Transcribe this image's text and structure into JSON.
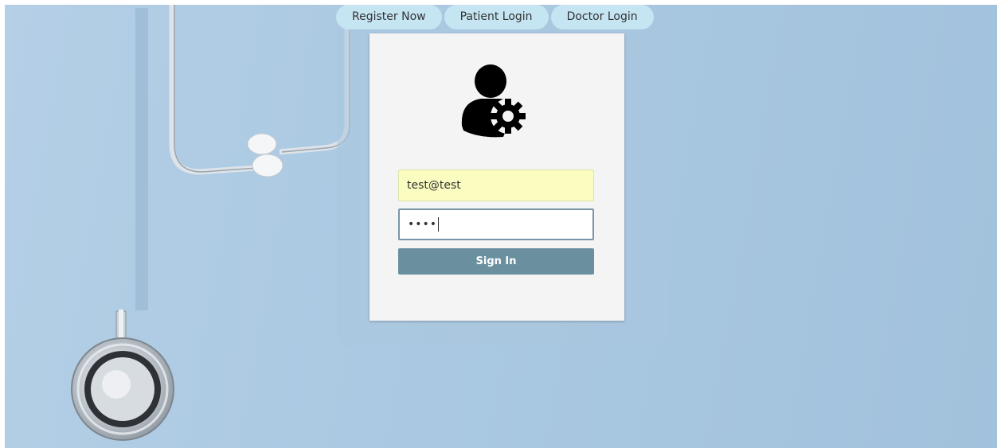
{
  "nav": {
    "tabs": [
      {
        "label": "Register Now"
      },
      {
        "label": "Patient Login"
      },
      {
        "label": "Doctor Login"
      }
    ]
  },
  "form": {
    "avatar_icon": "user-gear-icon",
    "email_value": "test@test",
    "password_mask": "••••",
    "submit_label": "Sign In"
  },
  "background": {
    "image": "stethoscope-photo",
    "color": "#abc9e2"
  },
  "colors": {
    "tab_bg": "#c5e5f2",
    "card_bg": "#f4f4f4",
    "autofill_bg": "#fafdbf",
    "button_bg": "#6a909f"
  }
}
